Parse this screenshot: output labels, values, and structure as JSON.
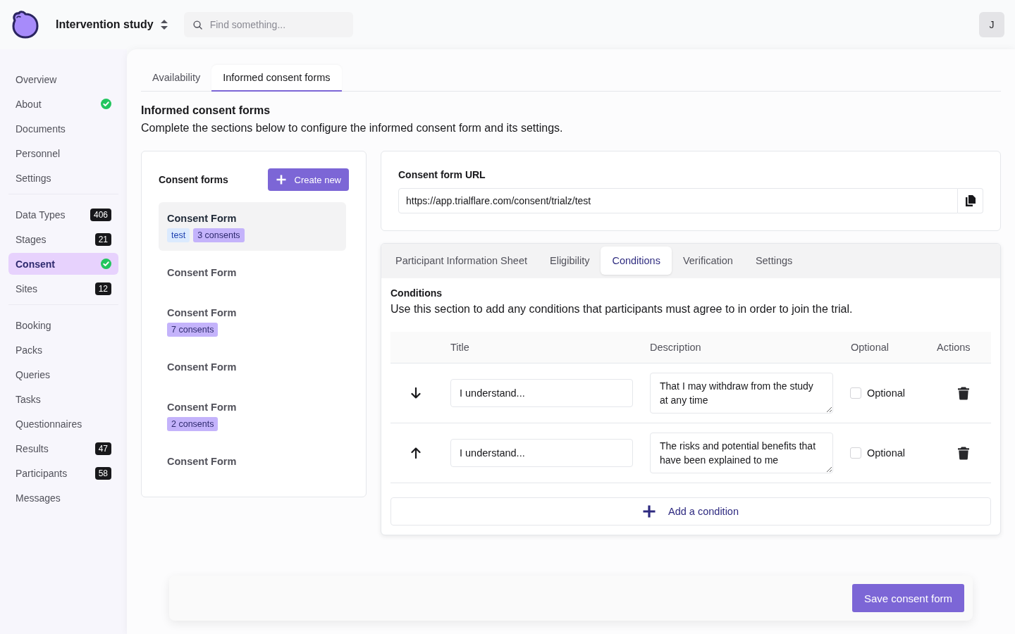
{
  "header": {
    "project": "Intervention study",
    "search": {
      "placeholder": "Find something..."
    },
    "avatar": "J"
  },
  "sidebar": {
    "groups": [
      {
        "items": [
          {
            "label": "Overview",
            "selected": false,
            "complete": false
          },
          {
            "label": "About",
            "selected": false,
            "complete": true
          },
          {
            "label": "Documents",
            "selected": false,
            "complete": false
          },
          {
            "label": "Personnel",
            "selected": false,
            "complete": false
          },
          {
            "label": "Settings",
            "selected": false,
            "complete": false
          }
        ]
      },
      {
        "items": [
          {
            "label": "Data Types",
            "count": "406",
            "selected": false,
            "complete": false
          },
          {
            "label": "Stages",
            "count": "21",
            "selected": false,
            "complete": false
          },
          {
            "label": "Consent",
            "selected": true,
            "complete": true
          },
          {
            "label": "Sites",
            "count": "12",
            "selected": false,
            "complete": false
          }
        ]
      },
      {
        "items": [
          {
            "label": "Booking",
            "selected": false,
            "complete": false
          },
          {
            "label": "Packs",
            "selected": false,
            "complete": false
          },
          {
            "label": "Queries",
            "selected": false,
            "complete": false
          },
          {
            "label": "Tasks",
            "selected": false,
            "complete": false
          },
          {
            "label": "Questionnaires",
            "selected": false,
            "complete": false
          },
          {
            "label": "Results",
            "count": "47",
            "selected": false,
            "complete": false
          },
          {
            "label": "Participants",
            "count": "58",
            "selected": false,
            "complete": false
          },
          {
            "label": "Messages",
            "selected": false,
            "complete": false
          }
        ]
      }
    ]
  },
  "tabs": [
    {
      "label": "Availability",
      "selected": false
    },
    {
      "label": "Informed consent forms",
      "selected": true
    }
  ],
  "section": {
    "title": "Informed consent forms",
    "description": "Complete the sections below to configure the informed consent form and its settings."
  },
  "consent_forms": {
    "title": "Consent forms",
    "create_button": "Create new",
    "items": [
      {
        "title": "Consent Form",
        "selected": true,
        "tags": [
          {
            "label": "test",
            "kind": "label"
          },
          {
            "label": "3 consents",
            "kind": "count"
          }
        ]
      },
      {
        "title": "Consent Form",
        "selected": false
      },
      {
        "title": "Consent Form",
        "selected": false,
        "tags": [
          {
            "label": "7 consents",
            "kind": "count"
          }
        ]
      },
      {
        "title": "Consent Form",
        "selected": false
      },
      {
        "title": "Consent Form",
        "selected": false,
        "tags": [
          {
            "label": "2 consents",
            "kind": "count"
          }
        ]
      },
      {
        "title": "Consent Form",
        "selected": false
      }
    ]
  },
  "url_card": {
    "label": "Consent form URL",
    "value": "https://app.trialflare.com/consent/trialz/test"
  },
  "editor": {
    "tabs": [
      {
        "label": "Participant Information Sheet",
        "selected": false
      },
      {
        "label": "Eligibility",
        "selected": false
      },
      {
        "label": "Conditions",
        "selected": true
      },
      {
        "label": "Verification",
        "selected": false
      },
      {
        "label": "Settings",
        "selected": false
      }
    ],
    "title": "Conditions",
    "description": "Use this section to add any conditions that participants must agree to in order to join the trial.",
    "table": {
      "columns": [
        "Title",
        "Description",
        "Optional",
        "Actions"
      ],
      "rows": [
        {
          "kind": "down",
          "title": "I understand...",
          "description": "That I may withdraw from the study at any time",
          "optional": false,
          "optional_label": "Optional"
        },
        {
          "kind": "up",
          "title": "I understand...",
          "description": "The risks and potential benefits that have been explained to me",
          "optional": false,
          "optional_label": "Optional"
        }
      ]
    },
    "add_button": "Add a condition"
  },
  "footer": {
    "save_button": "Save consent form"
  }
}
